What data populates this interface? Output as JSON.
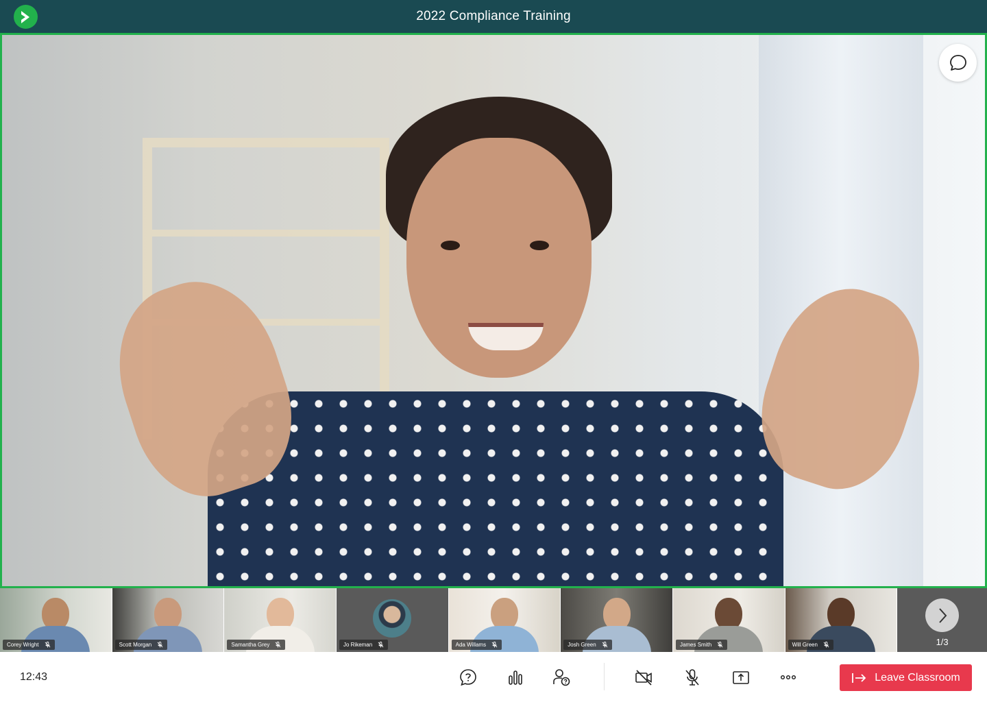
{
  "header": {
    "title": "2022 Compliance Training",
    "logo_icon": "play-arrow-icon",
    "bg_color": "#1a4a52"
  },
  "main_video": {
    "chat_icon": "chat-bubble-icon",
    "border_color": "#22b14c"
  },
  "participants": [
    {
      "name": "Corey Wright",
      "mic": "muted"
    },
    {
      "name": "Scott Morgan",
      "mic": "muted"
    },
    {
      "name": "Samantha Grey",
      "mic": "muted"
    },
    {
      "name": "Jo Rikeman",
      "mic": "muted"
    },
    {
      "name": "Ada Willams",
      "mic": "muted"
    },
    {
      "name": "Josh Green",
      "mic": "muted"
    },
    {
      "name": "James Smith",
      "mic": "muted"
    },
    {
      "name": "Will Green",
      "mic": "muted"
    }
  ],
  "pager": {
    "label": "1/3",
    "next_icon": "chevron-right-icon"
  },
  "toolbar": {
    "time": "12:43",
    "icons": [
      "question-icon",
      "poll-chart-icon",
      "participant-question-icon",
      "camera-off-icon",
      "mic-off-icon",
      "share-screen-icon",
      "more-icon"
    ],
    "leave_label": "Leave Classroom",
    "leave_color": "#e8394d"
  }
}
